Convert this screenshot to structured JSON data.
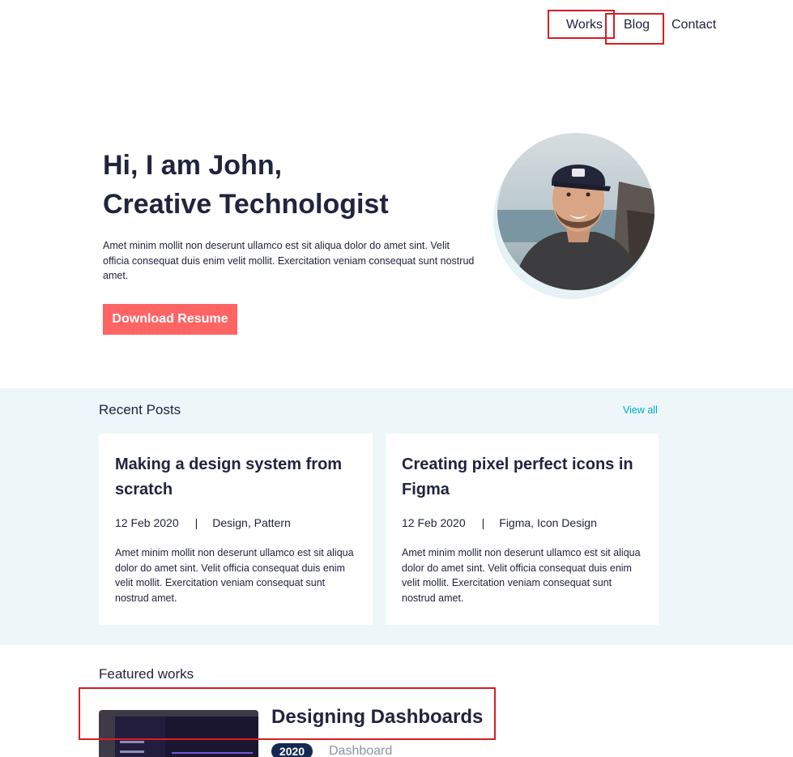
{
  "nav": {
    "works": "Works",
    "blog": "Blog",
    "contact": "Contact"
  },
  "hero": {
    "title_line1": "Hi, I am John,",
    "title_line2": "Creative Technologist",
    "text": "Amet minim mollit non deserunt ullamco est sit aliqua dolor do amet sint. Velit officia consequat duis enim velit mollit. Exercitation veniam consequat sunt nostrud amet.",
    "button": "Download Resume"
  },
  "recent_posts": {
    "heading": "Recent Posts",
    "view_all": "View all",
    "posts": [
      {
        "title": "Making a design system from scratch",
        "date": "12 Feb 2020",
        "separator": "|",
        "tags": "Design, Pattern",
        "body": "Amet minim mollit non deserunt ullamco est sit aliqua dolor do amet sint. Velit officia consequat duis enim velit mollit. Exercitation veniam consequat sunt nostrud amet."
      },
      {
        "title": "Creating pixel perfect icons in Figma",
        "date": "12 Feb 2020",
        "separator": "|",
        "tags": "Figma, Icon Design",
        "body": "Amet minim mollit non deserunt ullamco est sit aliqua dolor do amet sint. Velit officia consequat duis enim velit mollit. Exercitation veniam consequat sunt nostrud amet."
      }
    ]
  },
  "featured": {
    "heading": "Featured works",
    "works": [
      {
        "title": "Designing Dashboards",
        "year": "2020",
        "category": "Dashboard"
      }
    ]
  },
  "colors": {
    "text": "#21243d",
    "accent": "#ff6464",
    "link": "#00a8cc",
    "band": "#edf7fa",
    "badge": "#142850",
    "muted": "#8695a4",
    "highlight": "#d51f24"
  }
}
